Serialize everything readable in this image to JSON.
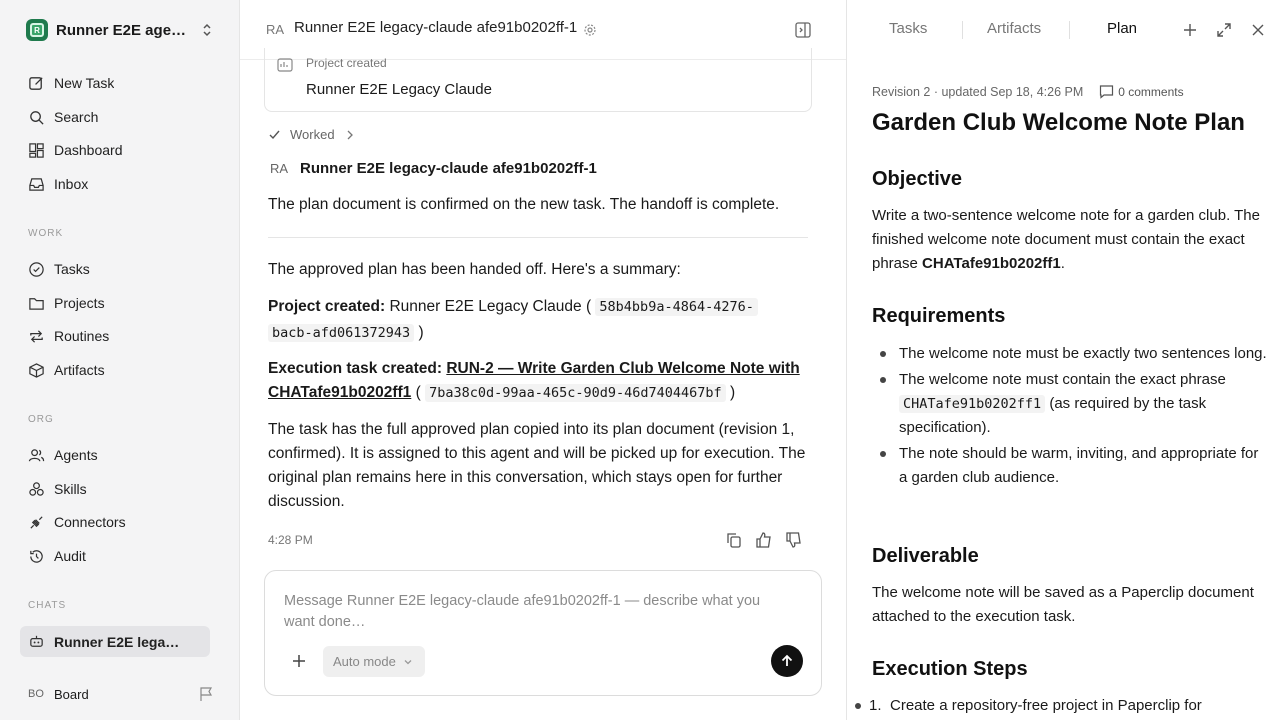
{
  "sidebar": {
    "workspace_name": "Runner E2E agen…",
    "nav": [
      {
        "label": "New Task",
        "icon": "edit-icon"
      },
      {
        "label": "Search",
        "icon": "search-icon"
      },
      {
        "label": "Dashboard",
        "icon": "dashboard-icon"
      },
      {
        "label": "Inbox",
        "icon": "inbox-icon"
      }
    ],
    "work_label": "WORK",
    "work": [
      {
        "label": "Tasks",
        "icon": "check-circle-icon"
      },
      {
        "label": "Projects",
        "icon": "folder-icon"
      },
      {
        "label": "Routines",
        "icon": "repeat-icon"
      },
      {
        "label": "Artifacts",
        "icon": "box-icon"
      }
    ],
    "org_label": "ORG",
    "org": [
      {
        "label": "Agents",
        "icon": "users-icon"
      },
      {
        "label": "Skills",
        "icon": "skills-icon"
      },
      {
        "label": "Connectors",
        "icon": "plug-icon"
      },
      {
        "label": "Audit",
        "icon": "history-icon"
      }
    ],
    "chats_label": "CHATS",
    "chats": [
      {
        "label": "Runner E2E lega…",
        "icon": "robot-icon"
      }
    ],
    "board": {
      "initials": "BO",
      "label": "Board"
    }
  },
  "main": {
    "header": {
      "initials": "RA",
      "title": "Runner E2E legacy-claude afe91b0202ff-1"
    },
    "project_card": {
      "label": "Project created",
      "name": "Runner E2E Legacy Claude"
    },
    "worked_label": "Worked",
    "agent": {
      "initials": "RA",
      "name": "Runner E2E legacy-claude afe91b0202ff-1"
    },
    "msg1": "The plan document is confirmed on the new task. The handoff is complete.",
    "msg2": "The approved plan has been handed off. Here's a summary:",
    "project_line": {
      "label": "Project created:",
      "text": " Runner E2E Legacy Claude (",
      "code1": "58b4bb9a-4864-4276-",
      "code2": "bacb-afd061372943",
      "close": ")"
    },
    "task_line": {
      "label": "Execution task created:",
      "link1": "RUN-2 — Write Garden Club Welcome Note with",
      "link2": "CHATafe91b0202ff1",
      "open": " (",
      "code": "7ba38c0d-99aa-465c-90d9-46d7404467bf",
      "close": ")"
    },
    "msg3": "The task has the full approved plan copied into its plan document (revision 1, confirmed). It is assigned to this agent and will be picked up for execution. The original plan remains here in this conversation, which stays open for further discussion.",
    "time": "4:28 PM",
    "composer": {
      "placeholder": "Message Runner E2E legacy-claude afe91b0202ff-1 — describe what you want done…",
      "mode": "Auto mode"
    }
  },
  "right": {
    "tabs": [
      "Tasks",
      "Artifacts",
      "Plan"
    ],
    "active_tab": "Plan",
    "revision": "Revision 2 · updated Sep 18, 4:26 PM",
    "comments": "0 comments",
    "title": "Garden Club Welcome Note Plan",
    "objective_h": "Objective",
    "objective_pre": "Write a two-sentence welcome note for a garden club. The finished welcome note document must contain the exact phrase ",
    "objective_bold": "CHATafe91b0202ff1",
    "objective_post": ".",
    "requirements_h": "Requirements",
    "req1": "The welcome note must be exactly two sentences long.",
    "req2_pre": "The welcome note must contain the exact phrase ",
    "req2_code": "CHATafe91b0202ff1",
    "req2_post": " (as required by the task specification).",
    "req3": "The note should be warm, inviting, and appropriate for a garden club audience.",
    "deliverable_h": "Deliverable",
    "deliverable": "The welcome note will be saved as a Paperclip document attached to the execution task.",
    "steps_h": "Execution Steps",
    "step1_num": "1.",
    "step1": "Create a repository-free project in Paperclip for"
  }
}
